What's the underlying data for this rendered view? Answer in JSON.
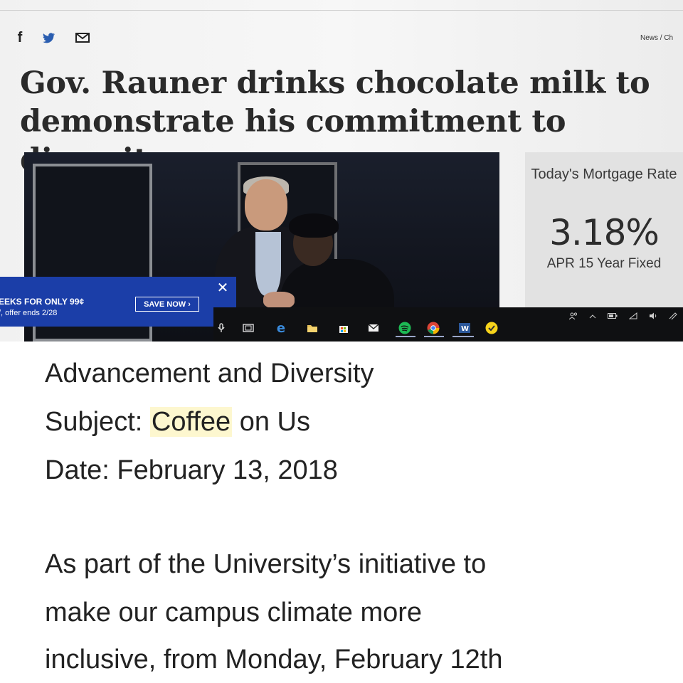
{
  "article": {
    "breadcrumb": "News / Ch",
    "headline": "Gov. Rauner drinks chocolate milk to demonstrate his commitment to diversity",
    "share_icons": [
      "facebook-icon",
      "twitter-icon",
      "mail-icon"
    ],
    "facebook_glyph": "f"
  },
  "mortgage_ad": {
    "title": "Today's Mortgage Rate",
    "rate": "3.18%",
    "term": "APR 15 Year Fixed"
  },
  "subscribe_banner": {
    "line1": "EEKS FOR ONLY 99¢",
    "line2": "/, offer ends 2/28",
    "button_label": "SAVE NOW ›",
    "close_glyph": "✕",
    "color": "#1b3ea8"
  },
  "taskbar": {
    "icons": [
      "microphone-icon",
      "task-view-icon",
      "edge-icon",
      "file-explorer-icon",
      "store-icon",
      "mail-icon",
      "spotify-icon",
      "chrome-icon",
      "word-icon",
      "norton-icon"
    ],
    "tray_icons": [
      "people-icon",
      "chevron-up-icon",
      "battery-icon",
      "wifi-icon",
      "volume-icon",
      "pen-icon"
    ]
  },
  "email": {
    "department": "Advancement and Diversity",
    "subject_label": "Subject:",
    "subject_highlight": "Coffee",
    "subject_rest": "on Us",
    "date_label": "Date:",
    "date_value": "February 13, 2018",
    "body_lines": [
      "As part of the University’s initiative to",
      "make our campus climate more",
      "inclusive, from Monday, February 12th"
    ],
    "highlight_color": "#fdf7cf"
  }
}
